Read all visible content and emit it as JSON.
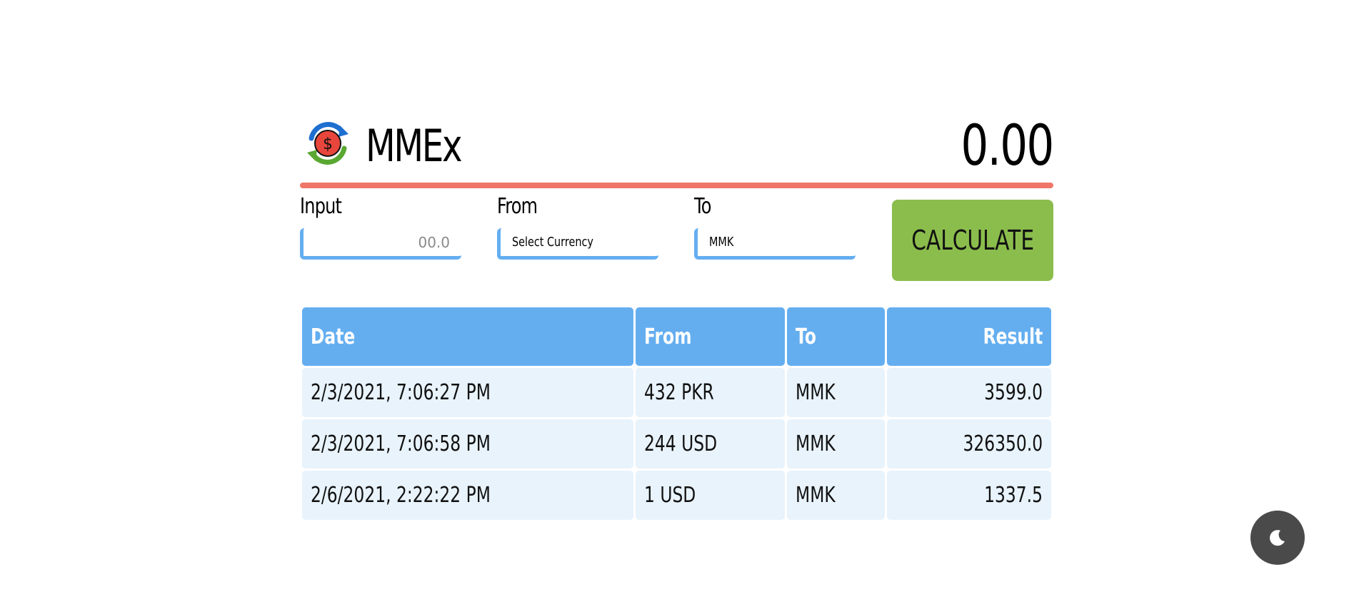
{
  "app": {
    "title": "MMEx",
    "total": "0.00",
    "logo_icon": "currency-exchange-icon"
  },
  "colors": {
    "accent_line": "#f0766a",
    "primary_blue": "#64aef0",
    "row_bg": "#e8f3fc",
    "calculate_green": "#8bbd4c",
    "toggle_bg": "#4a4a4a"
  },
  "form": {
    "input_label": "Input",
    "input_placeholder": "00.0",
    "from_label": "From",
    "from_value": "Select Currency",
    "to_label": "To",
    "to_value": "MMK",
    "calculate_label": "CALCULATE"
  },
  "history": {
    "columns": [
      "Date",
      "From",
      "To",
      "Result"
    ],
    "rows": [
      {
        "date": "2/3/2021, 7:06:27 PM",
        "from": "432 PKR",
        "to": "MMK",
        "result": "3599.0"
      },
      {
        "date": "2/3/2021, 7:06:58 PM",
        "from": "244 USD",
        "to": "MMK",
        "result": "326350.0"
      },
      {
        "date": "2/6/2021, 2:22:22 PM",
        "from": "1 USD",
        "to": "MMK",
        "result": "1337.5"
      }
    ]
  },
  "theme_toggle": {
    "icon": "moon-icon"
  }
}
